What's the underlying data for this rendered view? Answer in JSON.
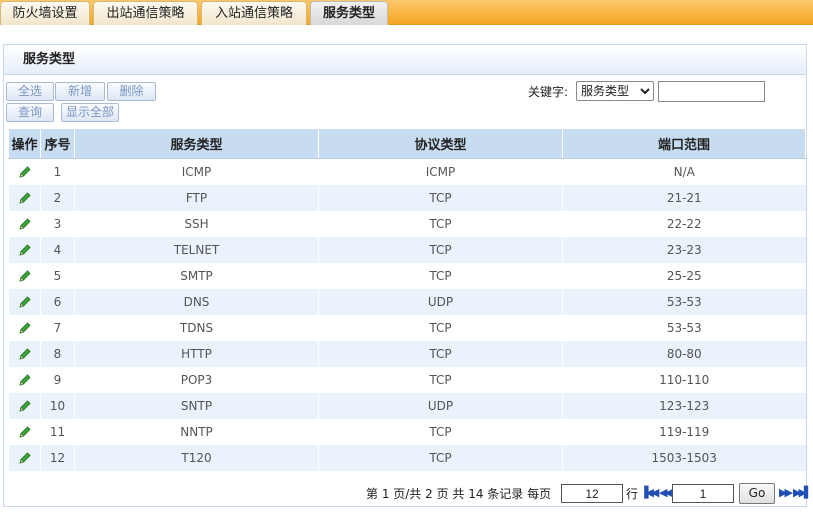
{
  "tabs": [
    {
      "label": "防火墙设置"
    },
    {
      "label": "出站通信策略"
    },
    {
      "label": "入站通信策略"
    },
    {
      "label": "服务类型"
    }
  ],
  "panel": {
    "title": "服务类型"
  },
  "toolbar": {
    "select_all": "全选",
    "add": "新增",
    "delete": "删除",
    "query": "查询",
    "show_all": "显示全部",
    "keyword_label": "关键字:",
    "keyword_select": "服务类型",
    "keyword_value": ""
  },
  "table": {
    "headers": {
      "action": "操作",
      "index": "序号",
      "service": "服务类型",
      "protocol": "协议类型",
      "ports": "端口范围"
    },
    "rows": [
      {
        "index": "1",
        "service": "ICMP",
        "protocol": "ICMP",
        "ports": "N/A"
      },
      {
        "index": "2",
        "service": "FTP",
        "protocol": "TCP",
        "ports": "21-21"
      },
      {
        "index": "3",
        "service": "SSH",
        "protocol": "TCP",
        "ports": "22-22"
      },
      {
        "index": "4",
        "service": "TELNET",
        "protocol": "TCP",
        "ports": "23-23"
      },
      {
        "index": "5",
        "service": "SMTP",
        "protocol": "TCP",
        "ports": "25-25"
      },
      {
        "index": "6",
        "service": "DNS",
        "protocol": "UDP",
        "ports": "53-53"
      },
      {
        "index": "7",
        "service": "TDNS",
        "protocol": "TCP",
        "ports": "53-53"
      },
      {
        "index": "8",
        "service": "HTTP",
        "protocol": "TCP",
        "ports": "80-80"
      },
      {
        "index": "9",
        "service": "POP3",
        "protocol": "TCP",
        "ports": "110-110"
      },
      {
        "index": "10",
        "service": "SNTP",
        "protocol": "UDP",
        "ports": "123-123"
      },
      {
        "index": "11",
        "service": "NNTP",
        "protocol": "TCP",
        "ports": "119-119"
      },
      {
        "index": "12",
        "service": "T120",
        "protocol": "TCP",
        "ports": "1503-1503"
      }
    ]
  },
  "pagination": {
    "summary": "第 1 页/共 2 页 共 14 条记录 每页",
    "per_page": "12",
    "row_unit": "行",
    "page_input": "1",
    "go": "Go"
  },
  "icons": {
    "edit": "pencil-icon",
    "first": "first-page-icon",
    "prev": "prev-page-icon",
    "next": "next-page-icon",
    "last": "last-page-icon"
  },
  "colors": {
    "tab_accent": "#f5a623",
    "header_bg": "#c7dcf0",
    "row_alt": "#eaf2fb",
    "edit_icon": "#2e8b2e"
  }
}
